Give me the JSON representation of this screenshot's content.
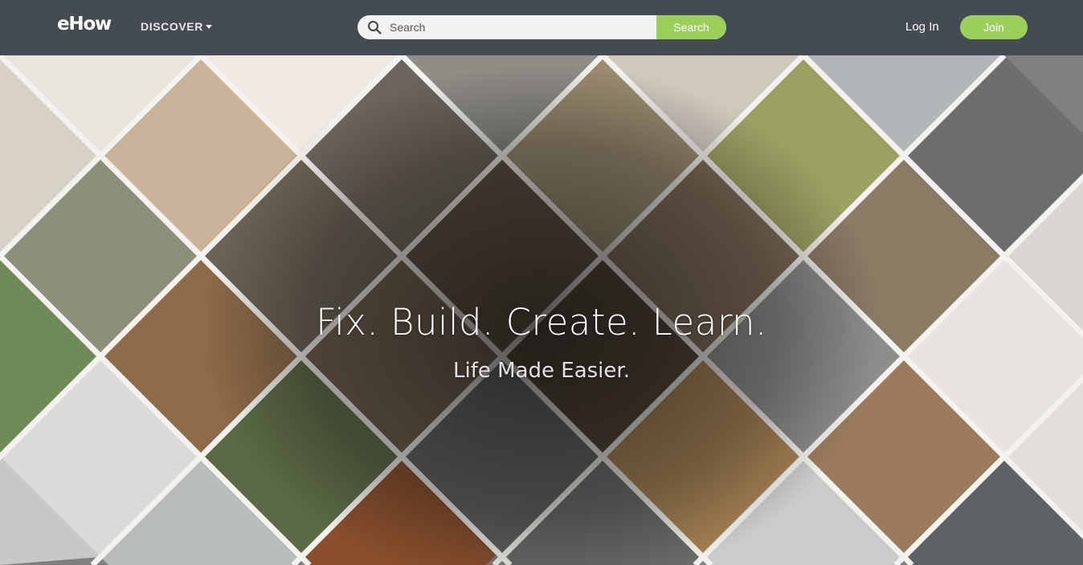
{
  "header": {
    "logo": "eHow",
    "discover_label": "DISCOVER",
    "search": {
      "placeholder": "Search",
      "button_label": "Search"
    },
    "login_label": "Log In",
    "join_label": "Join"
  },
  "hero": {
    "headline": "Fix. Build. Create. Learn.",
    "subline": "Life Made Easier."
  },
  "colors": {
    "header_bg": "#454b52",
    "accent_green": "#9bcf5b"
  },
  "icons": {
    "search": "magnifier-icon",
    "discover_caret": "caret-down-icon"
  }
}
